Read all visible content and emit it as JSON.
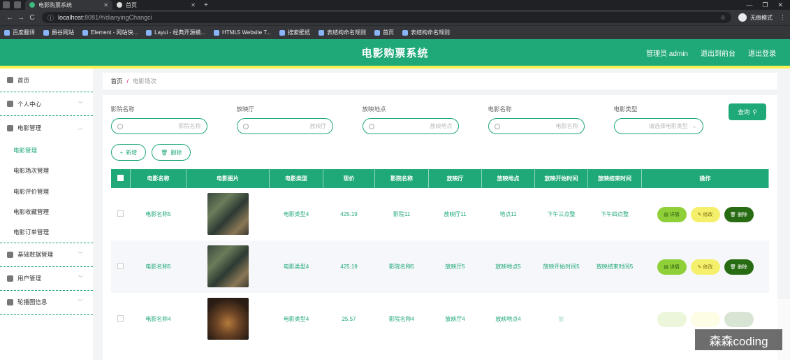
{
  "browser": {
    "tabs": [
      {
        "label": "电影购票系统",
        "active": true
      },
      {
        "label": "首页",
        "active": false
      }
    ],
    "url_host": "localhost",
    "url_rest": ":8081/#/dianyingChangci",
    "profile": "无痕模式",
    "bookmarks": [
      "百度翻译",
      "爵谷网站",
      "Element - 网站快...",
      "Layui - 经典开源模...",
      "HTML5 Website T...",
      "搜索壁纸",
      "表结构命名规则",
      "首页",
      "表结构命名规则"
    ]
  },
  "header": {
    "title": "电影购票系统",
    "user": "管理员 admin",
    "back": "退出到前台",
    "logout": "退出登录"
  },
  "sidebar": {
    "home": "首页",
    "personal": "个人中心",
    "movie_mgmt": "电影管理",
    "submenu": [
      "电影管理",
      "电影场次管理",
      "电影评价管理",
      "电影收藏管理",
      "电影订单管理"
    ],
    "basic": "基础数据管理",
    "users": "用户管理",
    "carousel": "轮播图信息"
  },
  "breadcrumb": {
    "home": "首页",
    "sep": "/",
    "current": "电影场次"
  },
  "filters": [
    {
      "label": "影院名称",
      "placeholder": "影院名称"
    },
    {
      "label": "放映厅",
      "placeholder": "放映厅"
    },
    {
      "label": "放映地点",
      "placeholder": "放映地点"
    },
    {
      "label": "电影名称",
      "placeholder": "电影名称"
    },
    {
      "label": "电影类型",
      "placeholder": "请选择电影类型"
    }
  ],
  "query_label": "查询",
  "add_label": "新增",
  "delete_label": "删除",
  "table": {
    "headers": [
      "电影名称",
      "电影图片",
      "电影类型",
      "现价",
      "影院名称",
      "放映厅",
      "放映地点",
      "放映开始时间",
      "放映结束时间",
      "操作"
    ],
    "rows": [
      {
        "name": "电影名称5",
        "type": "电影类型4",
        "price": "425.19",
        "cinema": "影院11",
        "hall": "放映厅11",
        "place": "地点11",
        "start": "下午三点整",
        "end": "下午四点整"
      },
      {
        "name": "电影名称5",
        "type": "电影类型4",
        "price": "425.19",
        "cinema": "影院名称5",
        "hall": "放映厅5",
        "place": "放映地点5",
        "start": "放映开始时间5",
        "end": "放映结束时间5"
      },
      {
        "name": "电影名称4",
        "type": "电影类型4",
        "price": "25.57",
        "cinema": "影院名称4",
        "hall": "放映厅4",
        "place": "放映地点4",
        "start": "放",
        "end": ""
      }
    ],
    "ops": {
      "detail": "详情",
      "edit": "修改",
      "del": "删除"
    }
  },
  "watermark": "森森coding",
  "colors": {
    "primary": "#1fa878",
    "header_border": "#f7f150",
    "detail": "#8fcf38",
    "edit": "#f5f06b",
    "del": "#276b12"
  }
}
